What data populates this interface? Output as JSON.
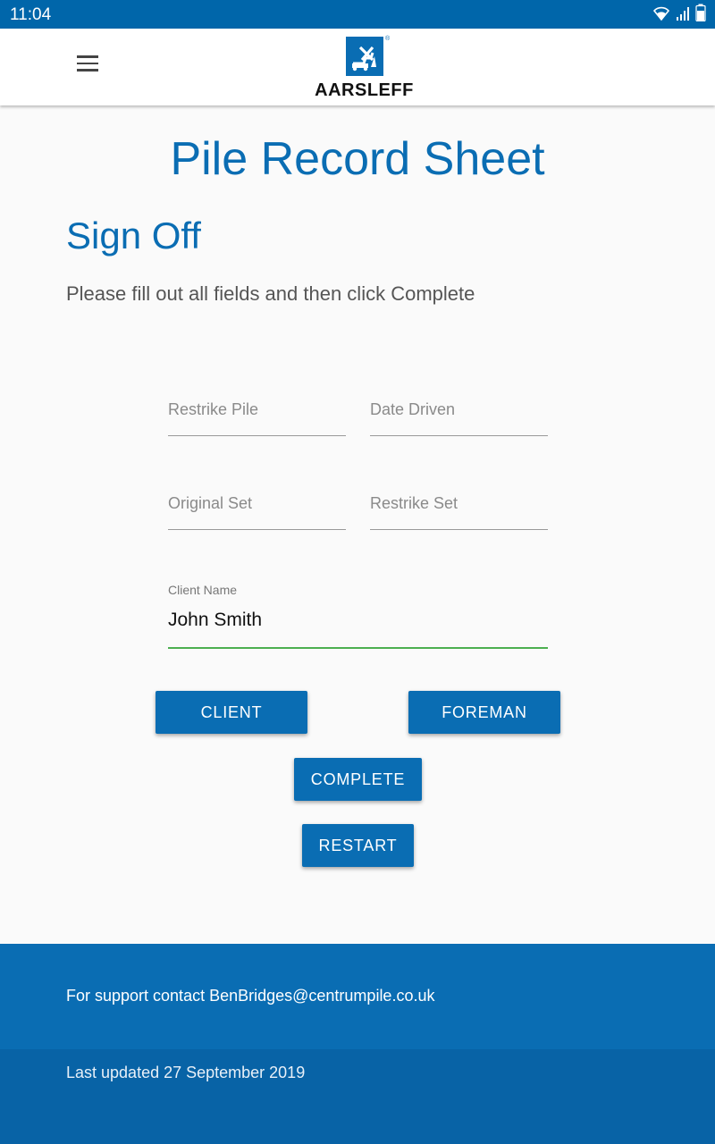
{
  "status_bar": {
    "time": "11:04",
    "icons": [
      "wifi-icon",
      "signal-icon",
      "battery-icon"
    ]
  },
  "header": {
    "menu_icon": "hamburger-menu-icon",
    "logo_text": "AARSLEFF",
    "logo_reg": "®"
  },
  "page": {
    "title": "Pile Record Sheet",
    "section_title": "Sign Off",
    "instructions": "Please fill out all fields and then click Complete"
  },
  "form": {
    "restrike_pile": {
      "placeholder": "Restrike Pile",
      "value": ""
    },
    "date_driven": {
      "placeholder": "Date Driven",
      "value": ""
    },
    "original_set": {
      "placeholder": "Original Set",
      "value": ""
    },
    "restrike_set": {
      "placeholder": "Restrike Set",
      "value": ""
    },
    "client_name": {
      "label": "Client Name",
      "value": "John Smith"
    }
  },
  "buttons": {
    "client": "CLIENT",
    "foreman": "FOREMAN",
    "complete": "COMPLETE",
    "restart": "RESTART"
  },
  "footer": {
    "support": "For support contact BenBridges@centrumpile.co.uk",
    "updated": "Last updated 27 September 2019"
  },
  "colors": {
    "brand": "#0a6db3",
    "status_bar": "#0066aa",
    "active_underline": "#4caf50"
  }
}
